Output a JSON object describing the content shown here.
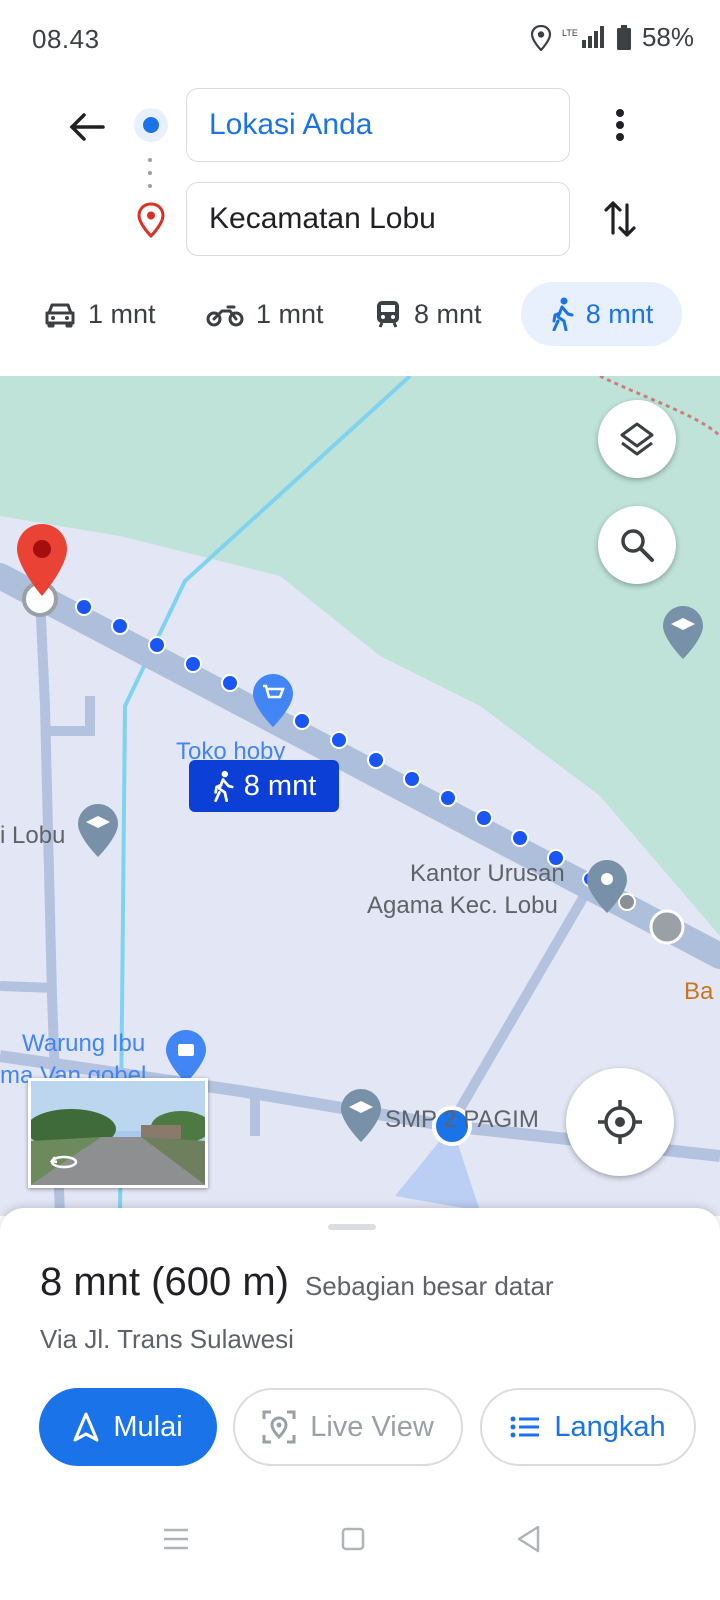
{
  "status": {
    "time": "08.43",
    "battery": "58%",
    "network": "LTE"
  },
  "header": {
    "origin": "Lokasi Anda",
    "destination": "Kecamatan Lobu"
  },
  "modes": [
    {
      "icon": "car-icon",
      "label": "1 mnt"
    },
    {
      "icon": "motorcycle-icon",
      "label": "1 mnt"
    },
    {
      "icon": "transit-icon",
      "label": "8 mnt"
    },
    {
      "icon": "walk-icon",
      "label": "8 mnt",
      "active": true
    }
  ],
  "map": {
    "eta_bubble": "8 mnt",
    "labels": {
      "toko": "Toko hoby",
      "lobu": "i Lobu",
      "kantor_line1": "Kantor Urusan",
      "kantor_line2": "Agama Kec. Lobu",
      "warung_line1": "Warung Ibu",
      "warung_line2": "ma Van gobel",
      "smp": "SMP 2 PAGIM",
      "ba": "Ba"
    },
    "colors": {
      "route": "#1a56f5",
      "land": "#e3e7f5",
      "park": "#bfe3d9",
      "river": "#7fd3f0"
    }
  },
  "sheet": {
    "duration": "8 mnt (600 m)",
    "terrain": "Sebagian besar datar",
    "via": "Via Jl. Trans Sulawesi",
    "start_label": "Mulai",
    "liveview_label": "Live View",
    "steps_label": "Langkah"
  }
}
